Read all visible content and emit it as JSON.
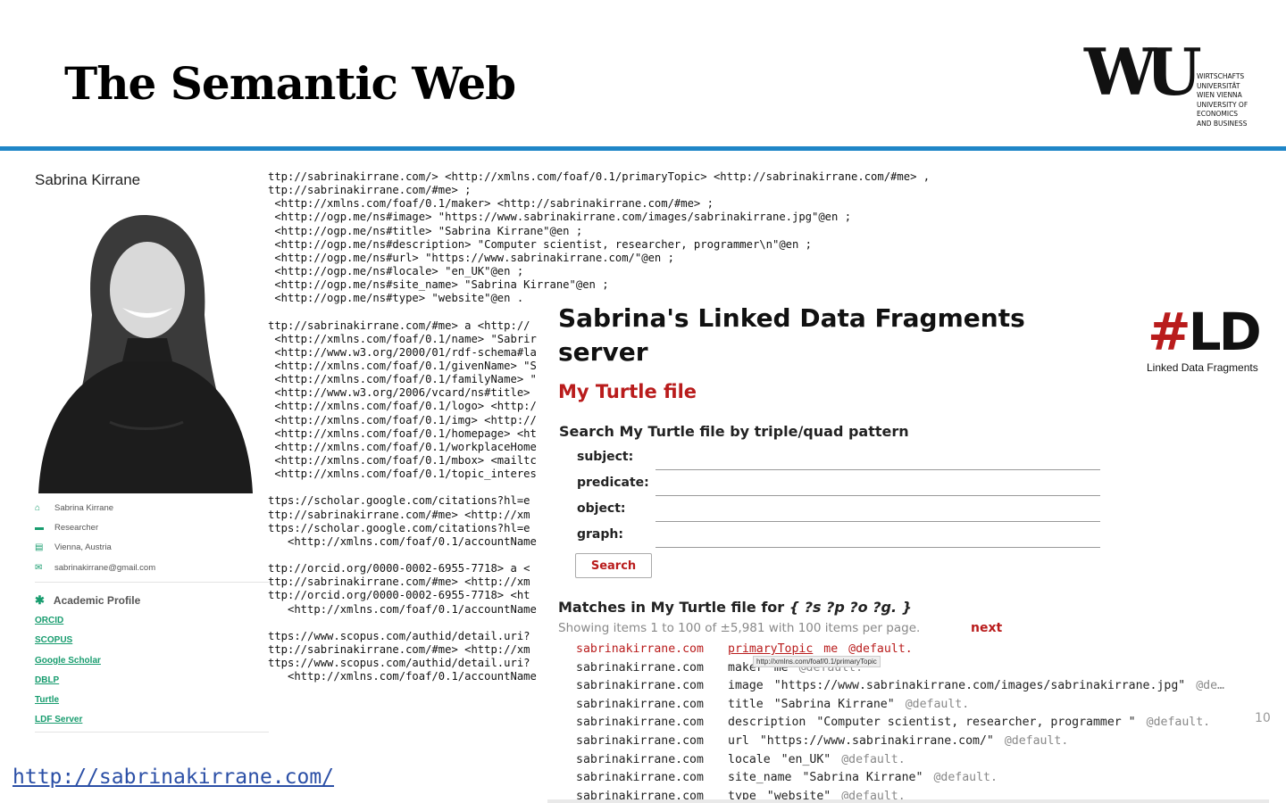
{
  "slide": {
    "title": "The Semantic Web",
    "page_number": "10",
    "site_url": "http://sabrinakirrane.com/"
  },
  "wu_logo": {
    "letters": "WU",
    "text": "WIRTSCHAFTS\nUNIVERSITÄT\nWIEN VIENNA\nUNIVERSITY OF\nECONOMICS\nAND BUSINESS"
  },
  "profile": {
    "name": "Sabrina Kirrane",
    "info": [
      {
        "icon": "home-icon",
        "glyph": "⌂",
        "text": "Sabrina Kirrane"
      },
      {
        "icon": "briefcase-icon",
        "glyph": "▬",
        "text": "Researcher"
      },
      {
        "icon": "id-card-icon",
        "glyph": "▤",
        "text": "Vienna, Austria"
      },
      {
        "icon": "envelope-icon",
        "glyph": "✉",
        "text": "sabrinakirrane@gmail.com"
      }
    ],
    "academic_heading": "Academic Profile",
    "links": [
      "ORCID",
      "SCOPUS",
      "Google Scholar",
      "DBLP",
      "Turtle",
      "LDF Server"
    ]
  },
  "turtle_top": [
    "ttp://sabrinakirrane.com/> <http://xmlns.com/foaf/0.1/primaryTopic> <http://sabrinakirrane.com/#me> ,",
    "ttp://sabrinakirrane.com/#me> ;",
    " <http://xmlns.com/foaf/0.1/maker> <http://sabrinakirrane.com/#me> ;",
    " <http://ogp.me/ns#image> \"https://www.sabrinakirrane.com/images/sabrinakirrane.jpg\"@en ;",
    " <http://ogp.me/ns#title> \"Sabrina Kirrane\"@en ;",
    " <http://ogp.me/ns#description> \"Computer scientist, researcher, programmer\\n\"@en ;",
    " <http://ogp.me/ns#url> \"https://www.sabrinakirrane.com/\"@en ;",
    " <http://ogp.me/ns#locale> \"en_UK\"@en ;",
    " <http://ogp.me/ns#site_name> \"Sabrina Kirrane\"@en ;",
    " <http://ogp.me/ns#type> \"website\"@en ."
  ],
  "turtle_bottom": [
    "",
    "ttp://sabrinakirrane.com/#me> a <http://",
    " <http://xmlns.com/foaf/0.1/name> \"Sabrir",
    " <http://www.w3.org/2000/01/rdf-schema#la",
    " <http://xmlns.com/foaf/0.1/givenName> \"S",
    " <http://xmlns.com/foaf/0.1/familyName> \"",
    " <http://www.w3.org/2006/vcard/ns#title>",
    " <http://xmlns.com/foaf/0.1/logo> <http:/",
    " <http://xmlns.com/foaf/0.1/img> <http://",
    " <http://xmlns.com/foaf/0.1/homepage> <ht",
    " <http://xmlns.com/foaf/0.1/workplaceHome",
    " <http://xmlns.com/foaf/0.1/mbox> <mailtc",
    " <http://xmlns.com/foaf/0.1/topic_interes",
    "",
    "ttps://scholar.google.com/citations?hl=e",
    "ttp://sabrinakirrane.com/#me> <http://xm",
    "ttps://scholar.google.com/citations?hl=e",
    "   <http://xmlns.com/foaf/0.1/accountName",
    "",
    "ttp://orcid.org/0000-0002-6955-7718> a <",
    "ttp://sabrinakirrane.com/#me> <http://xm",
    "ttp://orcid.org/0000-0002-6955-7718> <ht",
    "   <http://xmlns.com/foaf/0.1/accountName",
    "",
    "ttps://www.scopus.com/authid/detail.uri?",
    "ttp://sabrinakirrane.com/#me> <http://xm",
    "ttps://www.scopus.com/authid/detail.uri?",
    "   <http://xmlns.com/foaf/0.1/accountName"
  ],
  "ldf": {
    "title": "Sabrina's Linked Data Fragments server",
    "logo_hash": "#",
    "logo_letters": "LD",
    "logo_caption": "Linked Data Fragments",
    "dataset_title": "My Turtle file",
    "search_heading": "Search My Turtle file by triple/quad pattern",
    "fields": [
      {
        "label": "subject:",
        "value": ""
      },
      {
        "label": "predicate:",
        "value": ""
      },
      {
        "label": "object:",
        "value": ""
      },
      {
        "label": "graph:",
        "value": ""
      }
    ],
    "search_label": "Search",
    "matches_prefix": "Matches in My Turtle file for ",
    "matches_pattern": "{ ?s ?p ?o ?g. }",
    "showing": "Showing items 1 to 100 of ±5,981 with 100 items per page.",
    "next_label": "next",
    "tooltip": "http://xmlns.com/foaf/0.1/primaryTopic",
    "triples": [
      {
        "s": "sabrinakirrane.com",
        "p": "primaryTopic",
        "o": "me",
        "g": "@default."
      },
      {
        "s": "sabrinakirrane.com",
        "p": "maker",
        "o": "me",
        "g": "@default."
      },
      {
        "s": "sabrinakirrane.com",
        "p": "image",
        "o": "\"https://www.sabrinakirrane.com/images/sabrinakirrane.jpg\"",
        "g": "@de…"
      },
      {
        "s": "sabrinakirrane.com",
        "p": "title",
        "o": "\"Sabrina Kirrane\"",
        "g": "@default."
      },
      {
        "s": "sabrinakirrane.com",
        "p": "description",
        "o": "\"Computer scientist, researcher, programmer \"",
        "g": "@default."
      },
      {
        "s": "sabrinakirrane.com",
        "p": "url",
        "o": "\"https://www.sabrinakirrane.com/\"",
        "g": "@default."
      },
      {
        "s": "sabrinakirrane.com",
        "p": "locale",
        "o": "\"en_UK\"",
        "g": "@default."
      },
      {
        "s": "sabrinakirrane.com",
        "p": "site_name",
        "o": "\"Sabrina Kirrane\"",
        "g": "@default."
      },
      {
        "s": "sabrinakirrane.com",
        "p": "type",
        "o": "\"website\"",
        "g": "@default."
      }
    ]
  }
}
